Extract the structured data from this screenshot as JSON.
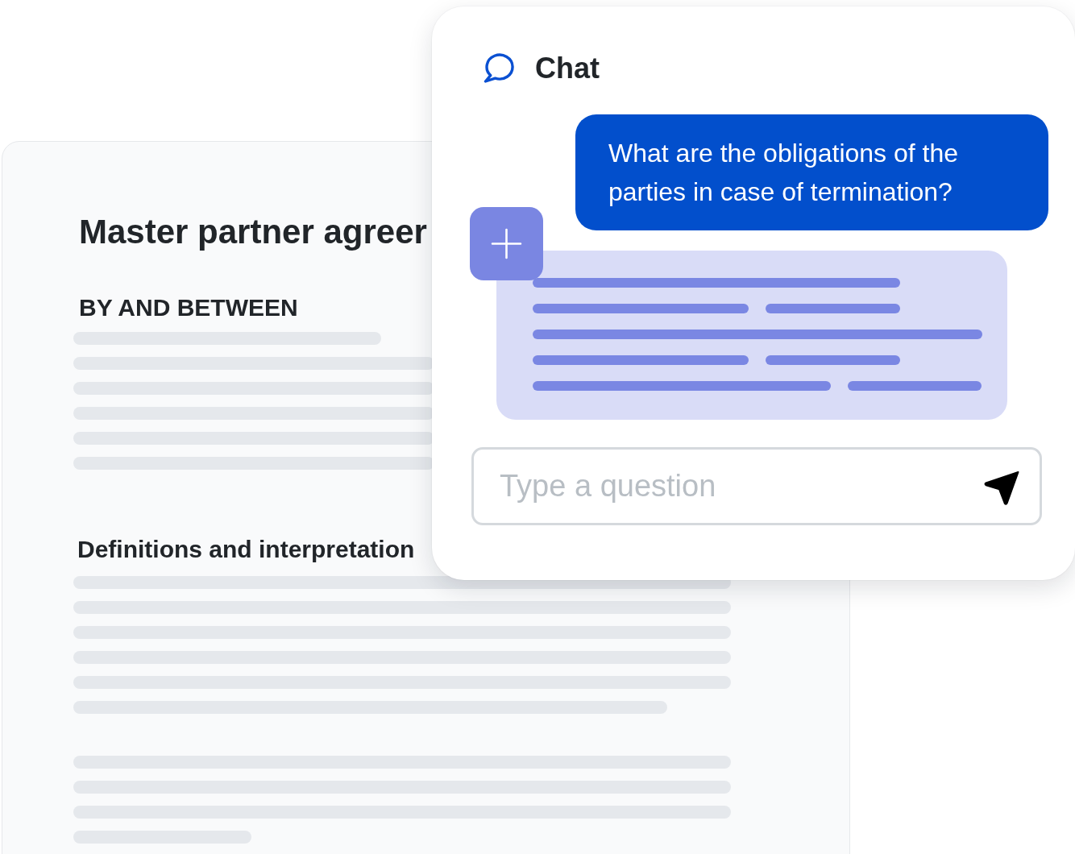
{
  "document": {
    "title": "Master partner agreer",
    "sections": [
      {
        "heading": "BY AND BETWEEN"
      },
      {
        "heading": "Definitions and interpretation"
      }
    ]
  },
  "chat": {
    "title": "Chat",
    "messages": [
      {
        "kind": "question",
        "text": "What are the obligations of the parties in case of termination?"
      },
      {
        "kind": "answer"
      }
    ],
    "input": {
      "placeholder": "Type a question"
    }
  }
}
